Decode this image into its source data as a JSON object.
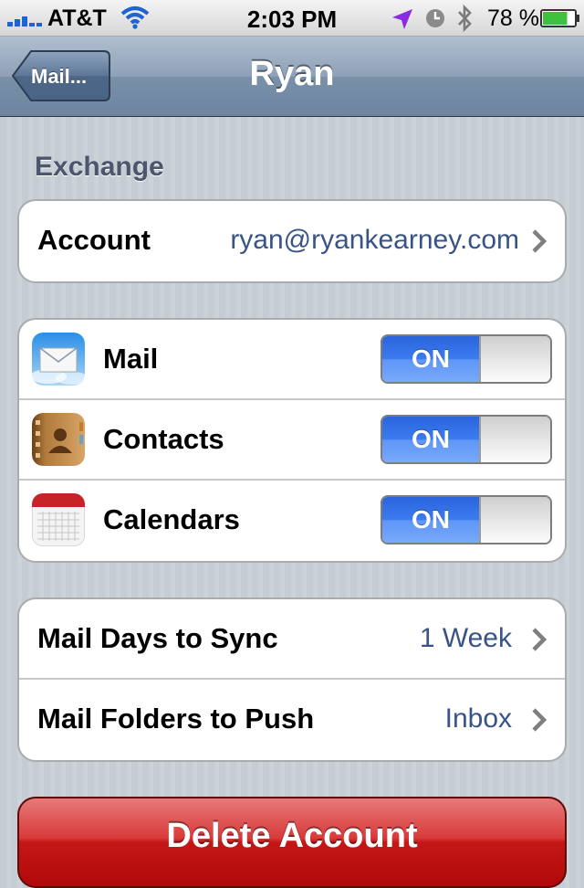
{
  "status_bar": {
    "carrier": "AT&T",
    "time": "2:03 PM",
    "battery_percent": "78 %",
    "battery_level": 0.78,
    "icons": [
      "signal-icon",
      "wifi-icon",
      "location-arrow-icon",
      "clock-icon",
      "bluetooth-icon",
      "battery-icon"
    ]
  },
  "nav": {
    "back_label": "Mail...",
    "title": "Ryan"
  },
  "section_header": "Exchange",
  "account": {
    "label": "Account",
    "value": "ryan@ryankearney.com"
  },
  "sync_items": [
    {
      "label": "Mail",
      "icon": "mail-app-icon",
      "toggle": "ON"
    },
    {
      "label": "Contacts",
      "icon": "contacts-app-icon",
      "toggle": "ON"
    },
    {
      "label": "Calendars",
      "icon": "calendar-app-icon",
      "toggle": "ON"
    }
  ],
  "settings": [
    {
      "label": "Mail Days to Sync",
      "value": "1 Week"
    },
    {
      "label": "Mail Folders to Push",
      "value": "Inbox"
    }
  ],
  "delete_button": "Delete Account",
  "colors": {
    "toggle_on": "#3a7cf0",
    "value_text": "#385487",
    "delete_red": "#c51616",
    "nav_blue": "#6d85a1"
  }
}
